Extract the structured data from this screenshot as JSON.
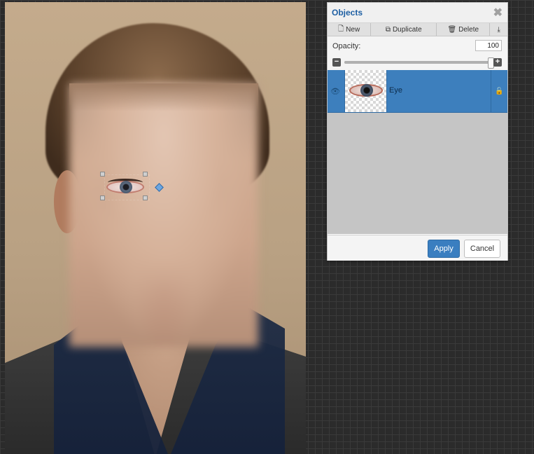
{
  "panel": {
    "title": "Objects",
    "close_icon": "close-icon",
    "toolbar": {
      "new_label": "New",
      "duplicate_label": "Duplicate",
      "delete_label": "Delete"
    },
    "opacity": {
      "label": "Opacity:",
      "value": "100",
      "slider_fraction": 1.0
    },
    "layers": [
      {
        "name": "Eye",
        "selected": true,
        "visible": true,
        "locked": false
      }
    ],
    "buttons": {
      "apply_label": "Apply",
      "cancel_label": "Cancel"
    }
  },
  "colors": {
    "accent": "#3d7fbd",
    "title": "#1d5fa3",
    "workspace": "#2b2b2b"
  }
}
